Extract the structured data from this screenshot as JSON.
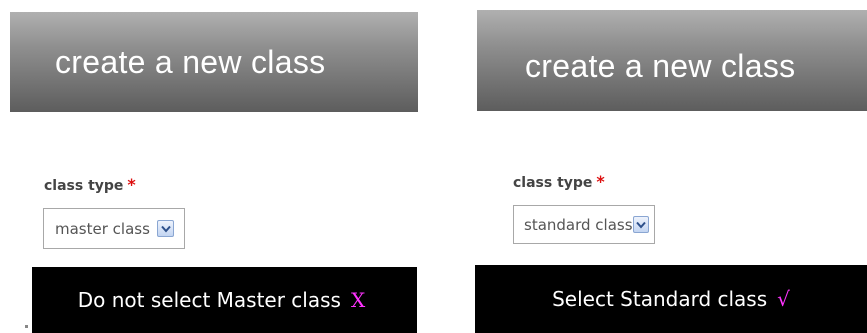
{
  "left_panel": {
    "header": "create a new class",
    "field_label": "class type",
    "required_marker": "*",
    "select_value": "master class",
    "caption_text": "Do not select Master class",
    "caption_mark": "X",
    "icons": {
      "dropdown": "chevron-down-icon"
    }
  },
  "right_panel": {
    "header": "create a new class",
    "field_label": "class type",
    "required_marker": "*",
    "select_value": "standard class",
    "caption_text": "Select Standard class",
    "caption_mark": "√",
    "icons": {
      "dropdown": "chevron-down-icon"
    }
  },
  "colors": {
    "header_gradient_top": "#b0b0b0",
    "header_gradient_bottom": "#5d5d5d",
    "required": "#dd1111",
    "caption_background": "#000000",
    "caption_mark": "#ff33ff",
    "dropdown_button": "#c3d5f2"
  }
}
